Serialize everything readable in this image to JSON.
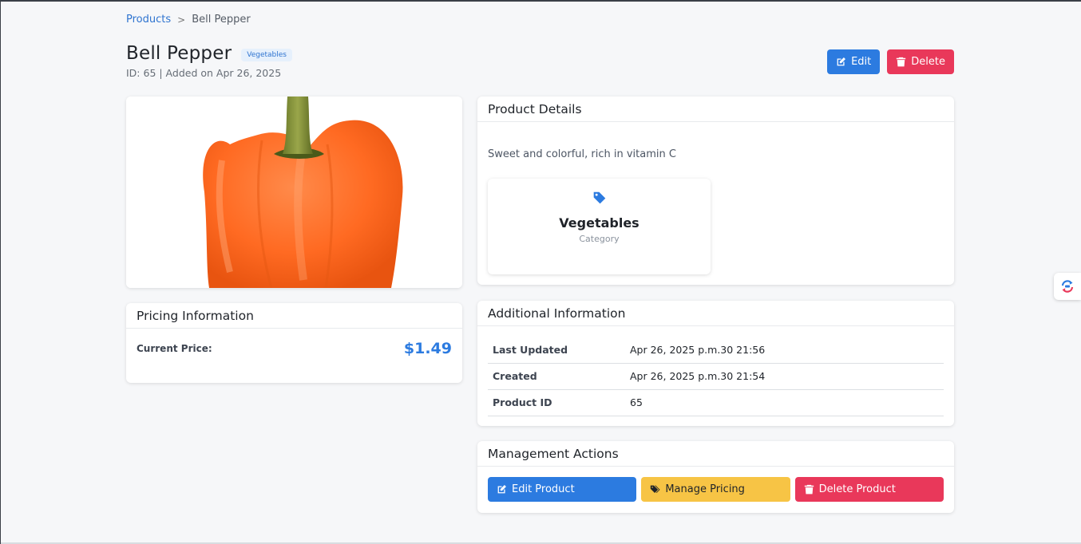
{
  "breadcrumb": {
    "root": "Products",
    "separator": ">",
    "current": "Bell Pepper"
  },
  "header": {
    "title": "Bell Pepper",
    "badge": "Vegetables",
    "subtitle": "ID: 65 | Added on Apr 26, 2025",
    "edit_label": "Edit",
    "delete_label": "Delete"
  },
  "image": {
    "alt": "Bell Pepper",
    "dominant_color": "#ff6f2e"
  },
  "pricing": {
    "title": "Pricing Information",
    "label": "Current Price:",
    "value": "$1.49"
  },
  "details": {
    "title": "Product Details",
    "description": "Sweet and colorful, rich in vitamin C",
    "category_name": "Vegetables",
    "category_caption": "Category",
    "category_icon": "tag-icon"
  },
  "additional": {
    "title": "Additional Information",
    "rows": [
      {
        "key": "Last Updated",
        "value": "Apr 26, 2025 p.m.30 21:56"
      },
      {
        "key": "Created",
        "value": "Apr 26, 2025 p.m.30 21:54"
      },
      {
        "key": "Product ID",
        "value": "65"
      }
    ]
  },
  "management": {
    "title": "Management Actions",
    "edit_label": "Edit Product",
    "pricing_label": "Manage Pricing",
    "delete_label": "Delete Product"
  },
  "colors": {
    "primary": "#2c7be0",
    "danger": "#e9385a",
    "warning": "#f7c445"
  }
}
